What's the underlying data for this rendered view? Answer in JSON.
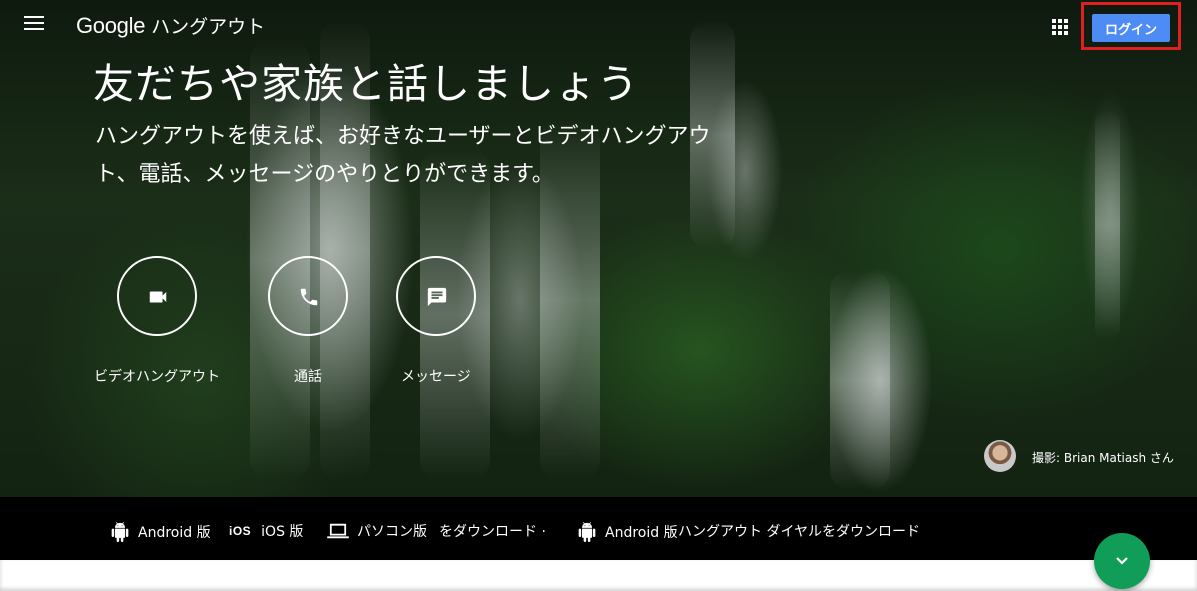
{
  "header": {
    "brand_google": "Google",
    "brand_product": "ハングアウト",
    "login_label": "ログイン",
    "menu_icon": "hamburger-menu-icon",
    "apps_icon": "apps-grid-icon"
  },
  "hero": {
    "headline": "友だちや家族と話しましょう",
    "subtitle": "ハングアウトを使えば、お好きなユーザーとビデオハングアウト、電話、メッセージのやりとりができます。",
    "features": [
      {
        "label": "ビデオハングアウト",
        "icon": "videocam-icon"
      },
      {
        "label": "通話",
        "icon": "phone-icon"
      },
      {
        "label": "メッセージ",
        "icon": "message-icon"
      }
    ],
    "photo_credit": "撮影: Brian Matiash さん"
  },
  "downloads": {
    "android_1": "Android 版",
    "ios": "iOS 版",
    "ios_mark": "iOS",
    "pc": "パソコン版",
    "suffix_1": "をダウンロード ·",
    "android_2": "Android 版",
    "dialer": "ハングアウト ダイヤルをダウンロード"
  },
  "fab": {
    "icon": "chevron-down-icon"
  },
  "colors": {
    "login_button": "#4d8cf5",
    "fab": "#0f9d58",
    "highlight_border": "#e02020"
  }
}
